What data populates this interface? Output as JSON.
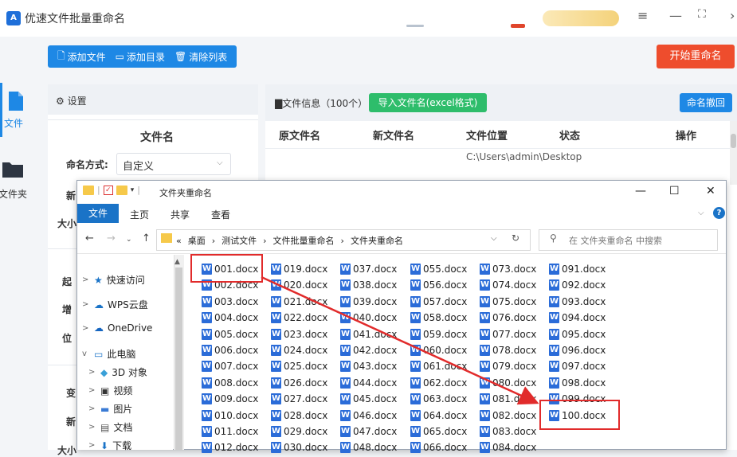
{
  "app": {
    "title": "优速文件批量重命名",
    "logo_text": "A"
  },
  "toolbar": {
    "add_file": "添加文件",
    "add_dir": "添加目录",
    "clear_list": "清除列表",
    "start": "开始重命名"
  },
  "rail": {
    "file": "文件",
    "folder": "文件夹"
  },
  "settings": {
    "title": "设置",
    "section": "文件名",
    "mode_label": "命名方式:",
    "mode_value": "自定义",
    "partial_labels": [
      "新",
      "大小",
      "起",
      "增",
      "位",
      "变",
      "新",
      "大小"
    ]
  },
  "info": {
    "title": "文件信息（100个）",
    "import": "导入文件名(excel格式)",
    "undo": "命名撤回",
    "columns": [
      "原文件名",
      "新文件名",
      "文件位置",
      "状态",
      "操作"
    ],
    "row0_path": "C:\\Users\\admin\\Desktop"
  },
  "explorer": {
    "title": "文件夹重命名",
    "ribbon": [
      "文件",
      "主页",
      "共享",
      "查看"
    ],
    "breadcrumb": [
      "«",
      "桌面",
      "测试文件",
      "文件批量重命名",
      "文件夹重命名"
    ],
    "search_placeholder": "在 文件夹重命名 中搜索",
    "nav": [
      {
        "label": "快速访问",
        "chev": ">"
      },
      {
        "label": "WPS云盘",
        "chev": ">"
      },
      {
        "label": "OneDrive",
        "chev": ">"
      },
      {
        "label": "此电脑",
        "chev": "v"
      },
      {
        "label": "3D 对象",
        "chev": ">"
      },
      {
        "label": "视频",
        "chev": ">"
      },
      {
        "label": "图片",
        "chev": ">"
      },
      {
        "label": "文档",
        "chev": ">"
      },
      {
        "label": "下载",
        "chev": ">"
      }
    ],
    "files": [
      [
        "001.docx",
        "002.docx",
        "003.docx",
        "004.docx",
        "005.docx",
        "006.docx",
        "007.docx",
        "008.docx",
        "009.docx",
        "010.docx",
        "011.docx",
        "012.docx"
      ],
      [
        "019.docx",
        "020.docx",
        "021.docx",
        "022.docx",
        "023.docx",
        "024.docx",
        "025.docx",
        "026.docx",
        "027.docx",
        "028.docx",
        "029.docx",
        "030.docx"
      ],
      [
        "037.docx",
        "038.docx",
        "039.docx",
        "040.docx",
        "041.docx",
        "042.docx",
        "043.docx",
        "044.docx",
        "045.docx",
        "046.docx",
        "047.docx",
        "048.docx"
      ],
      [
        "055.docx",
        "056.docx",
        "057.docx",
        "058.docx",
        "059.docx",
        "060.docx",
        "061.docx",
        "062.docx",
        "063.docx",
        "064.docx",
        "065.docx",
        "066.docx"
      ],
      [
        "073.docx",
        "074.docx",
        "075.docx",
        "076.docx",
        "077.docx",
        "078.docx",
        "079.docx",
        "080.docx",
        "081.docx",
        "082.docx",
        "083.docx",
        "084.docx"
      ],
      [
        "091.docx",
        "092.docx",
        "093.docx",
        "094.docx",
        "095.docx",
        "096.docx",
        "097.docx",
        "098.docx",
        "099.docx",
        "100.docx"
      ]
    ]
  }
}
